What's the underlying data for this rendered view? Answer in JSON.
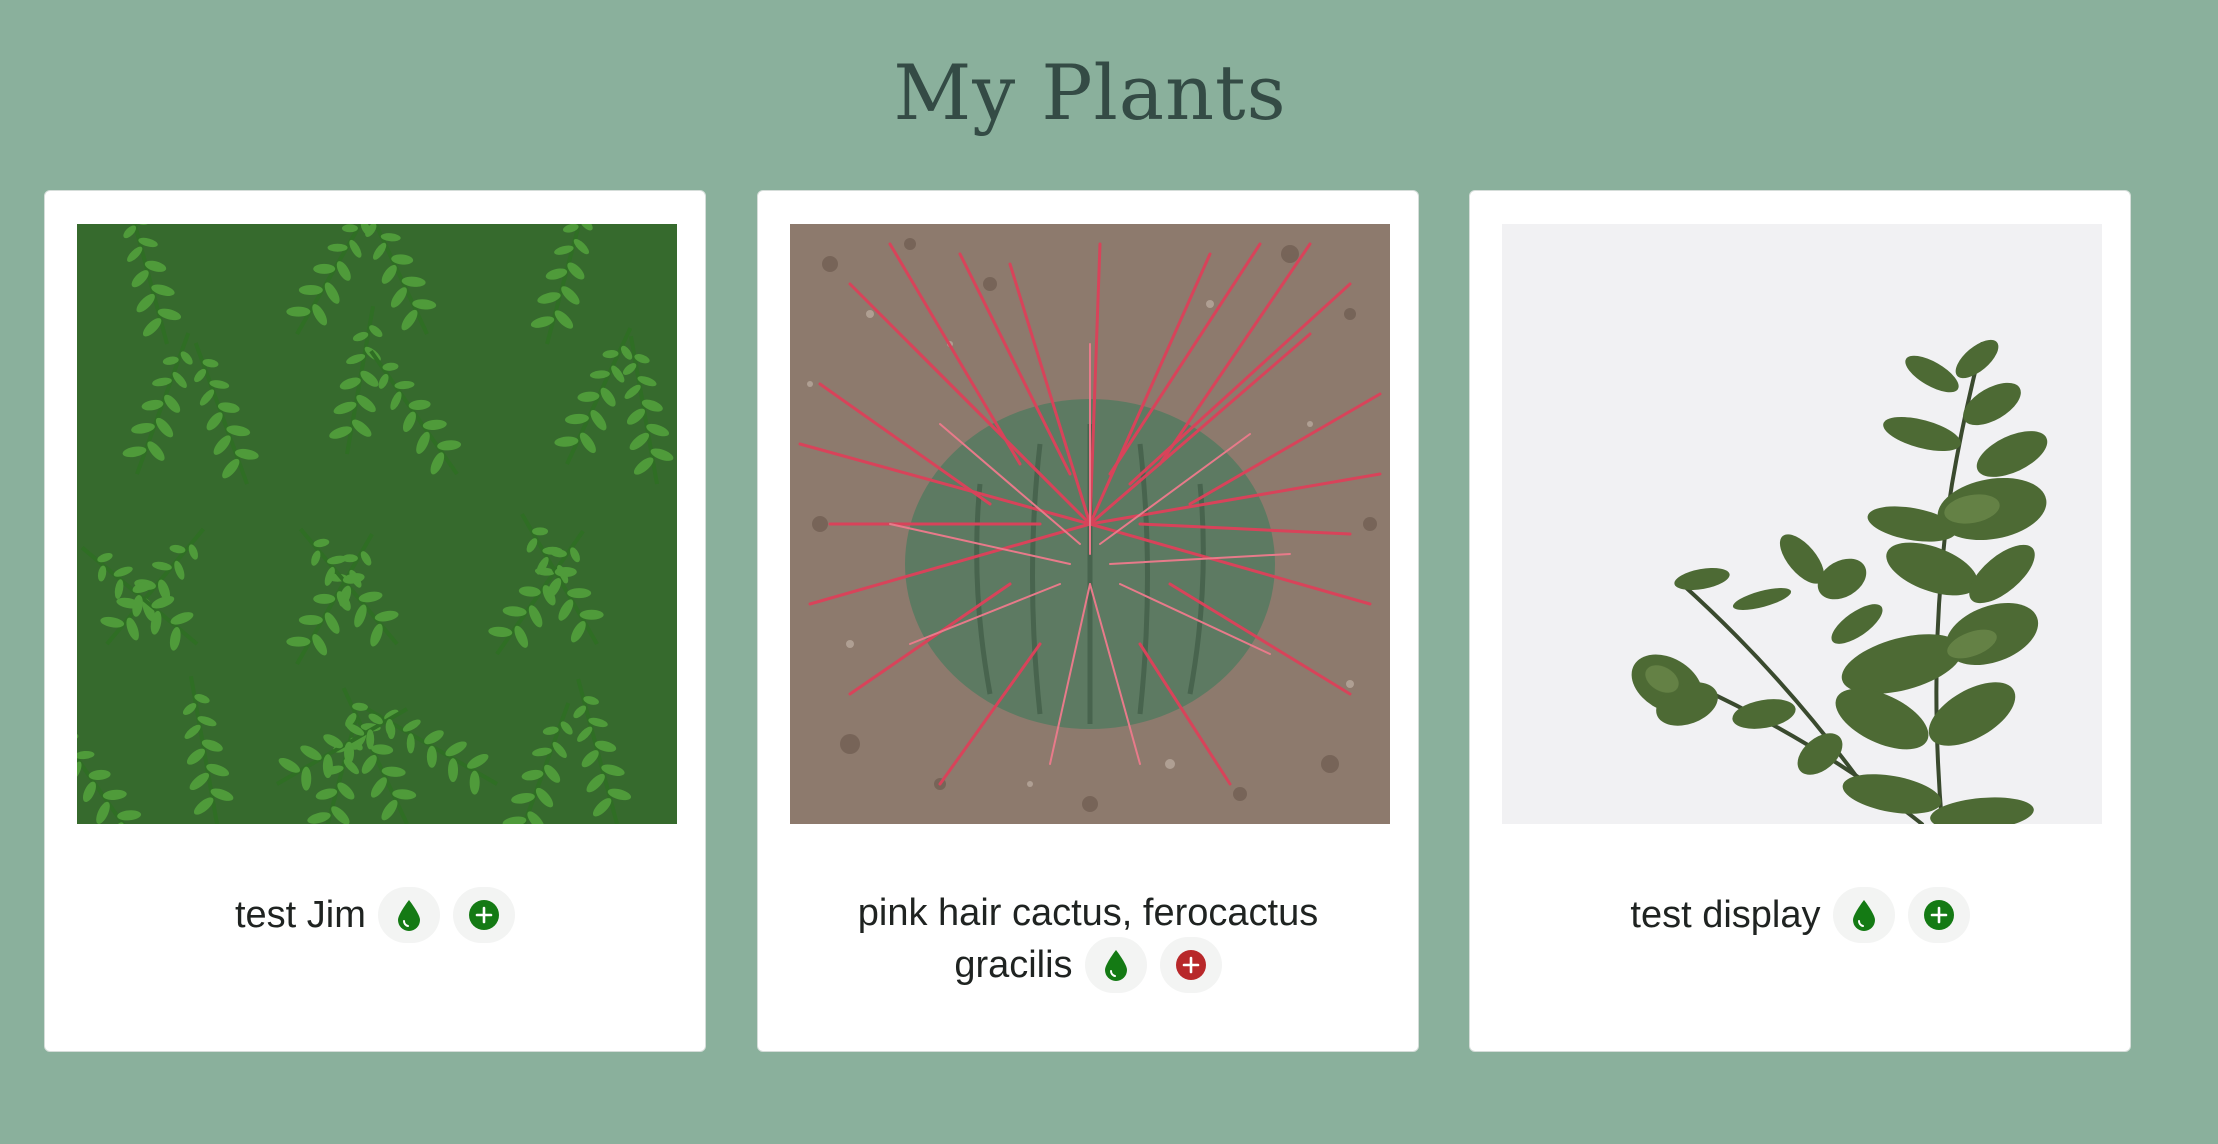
{
  "page": {
    "title": "My Plants"
  },
  "plants": [
    {
      "name": "test Jim",
      "photo_icon": "fern-photo",
      "water_icon": "water-drop-icon",
      "add_icon": "plus-circle-icon",
      "add_color": "#147a14"
    },
    {
      "name": "pink hair cactus, ferocactus gracilis",
      "photo_icon": "cactus-photo",
      "water_icon": "water-drop-icon",
      "add_icon": "plus-circle-icon",
      "add_color": "#b8282a"
    },
    {
      "name": "test display",
      "photo_icon": "eucalyptus-photo",
      "water_icon": "water-drop-icon",
      "add_icon": "plus-circle-icon",
      "add_color": "#147a14"
    }
  ],
  "colors": {
    "background": "#8ab09c",
    "title": "#344b45",
    "water": "#147a14"
  }
}
